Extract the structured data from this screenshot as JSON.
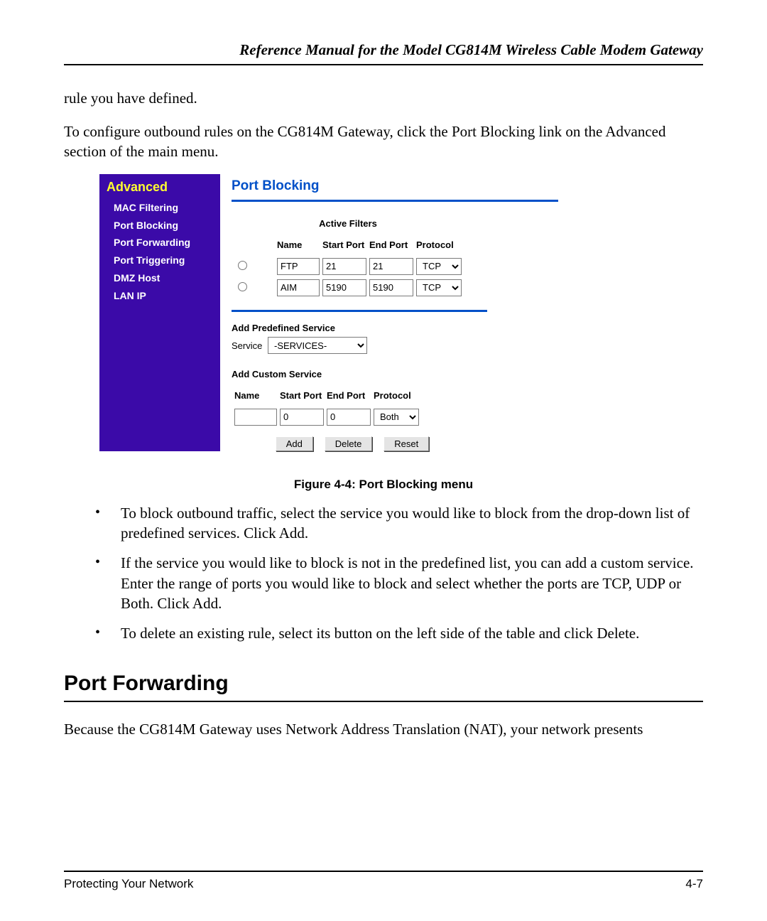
{
  "header": {
    "running_head": "Reference Manual for the Model CG814M Wireless Cable Modem Gateway"
  },
  "paragraphs": {
    "p1": "rule you have defined.",
    "p2": "To configure outbound rules on the CG814M Gateway, click the Port Blocking link on the Advanced section of the main menu."
  },
  "ui": {
    "sidebar": {
      "title": "Advanced",
      "items": [
        "MAC Filtering",
        "Port Blocking",
        "Port Forwarding",
        "Port Triggering",
        "DMZ Host",
        "LAN IP"
      ]
    },
    "panel_title": "Port Blocking",
    "active": {
      "caption": "Active Filters",
      "headers": {
        "name": "Name",
        "start": "Start Port",
        "end": "End Port",
        "proto": "Protocol"
      },
      "rows": [
        {
          "name": "FTP",
          "start": "21",
          "end": "21",
          "proto": "TCP"
        },
        {
          "name": "AIM",
          "start": "5190",
          "end": "5190",
          "proto": "TCP"
        }
      ]
    },
    "predefined": {
      "heading": "Add Predefined Service",
      "label": "Service",
      "selected": "-SERVICES-"
    },
    "custom": {
      "heading": "Add Custom Service",
      "headers": {
        "name": "Name",
        "start": "Start Port",
        "end": "End Port",
        "proto": "Protocol"
      },
      "row": {
        "name": "",
        "start": "0",
        "end": "0",
        "proto": "Both"
      }
    },
    "buttons": {
      "add": "Add",
      "delete": "Delete",
      "reset": "Reset"
    }
  },
  "figure_caption": "Figure 4-4: Port Blocking menu",
  "bullets": {
    "b1": "To block outbound traffic, select the service you would like to block from the drop-down list of predefined services. Click Add.",
    "b2": "If the service you would like to block is not in the predefined list, you can add a custom service. Enter the range of ports you would like to block and select whether the ports are TCP, UDP or Both. Click Add.",
    "b3": "To delete an existing rule, select its button on the left side of the table and click Delete."
  },
  "section_heading": "Port Forwarding",
  "closing_paragraph": "Because the CG814M Gateway uses Network Address Translation (NAT), your network presents",
  "footer": {
    "left": "Protecting Your Network",
    "right": "4-7"
  }
}
